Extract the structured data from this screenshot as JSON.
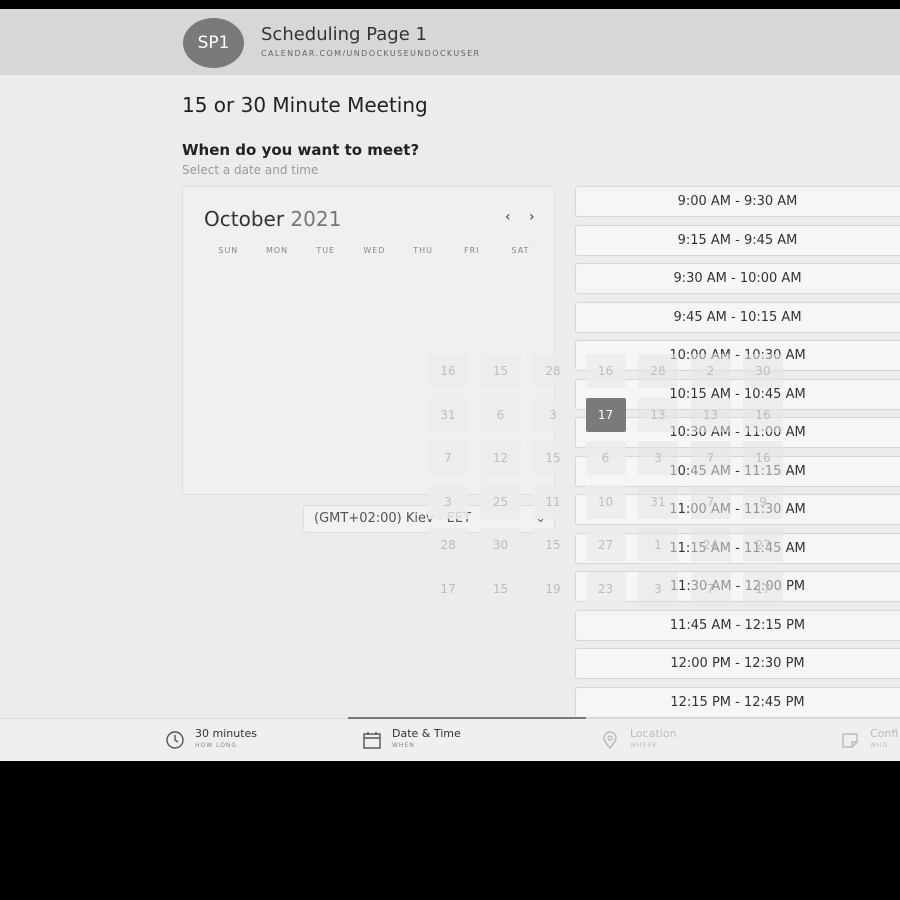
{
  "header": {
    "avatar": "SP1",
    "page_name": "Scheduling Page 1",
    "url": "CALENDAR.COM/UNDOCKUSEUNDOCKUSER"
  },
  "meeting_title": "15 or 30 Minute Meeting",
  "question": "When do you want to meet?",
  "subquestion": "Select a date and time",
  "calendar": {
    "month": "October",
    "year": "2021",
    "prev_icon": "chevron-left-icon",
    "next_icon": "chevron-right-icon",
    "weekdays": [
      "SUN",
      "MON",
      "TUE",
      "WED",
      "THU",
      "FRI",
      "SAT"
    ]
  },
  "timezone": "(GMT+02:00) Kiev - EET",
  "time_slots": [
    "9:00 AM - 9:30 AM",
    "9:15 AM - 9:45 AM",
    "9:30 AM - 10:00 AM",
    "9:45 AM - 10:15 AM",
    "10:00 AM - 10:30 AM",
    "10:15 AM - 10:45 AM",
    "10:30 AM - 11:00 AM",
    "10:45 AM - 11:15 AM",
    "11:00 AM - 11:30 AM",
    "11:15 AM - 11:45 AM",
    "11:30 AM - 12:00 PM",
    "11:45 AM - 12:15 PM",
    "12:00 PM - 12:30 PM",
    "12:15 PM - 12:45 PM"
  ],
  "overlay_days": [
    [
      "16",
      "15",
      "28",
      "16",
      "28",
      "2",
      "30"
    ],
    [
      "31",
      "6",
      "3",
      "17",
      "13",
      "13",
      "16"
    ],
    [
      "7",
      "12",
      "15",
      "6",
      "3",
      "7",
      "16"
    ],
    [
      "3",
      "25",
      "11",
      "10",
      "31",
      "7",
      "9"
    ],
    [
      "28",
      "30",
      "15",
      "27",
      "1",
      "24",
      "27"
    ],
    [
      "17",
      "15",
      "19",
      "23",
      "3",
      "7",
      "17"
    ]
  ],
  "selected_day": "17",
  "steps": [
    {
      "label": "30 minutes",
      "sub": "HOW LONG",
      "icon": "clock-icon"
    },
    {
      "label": "Date & Time",
      "sub": "WHEN",
      "icon": "calendar-icon"
    },
    {
      "label": "Location",
      "sub": "WHERE",
      "icon": "location-pin-icon"
    },
    {
      "label": "Confi",
      "sub": "WHO",
      "icon": "confirm-icon"
    }
  ]
}
